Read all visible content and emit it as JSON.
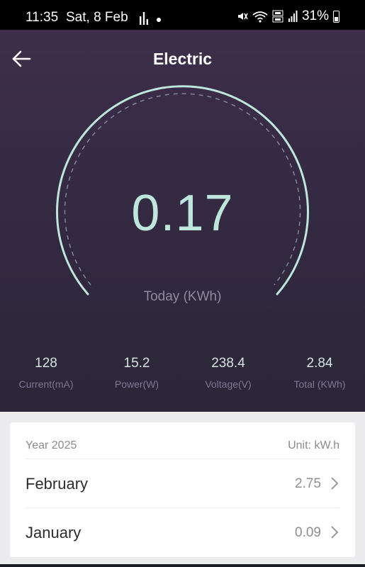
{
  "status_bar": {
    "time": "11:35",
    "date": "Sat, 8 Feb",
    "battery": "31%",
    "icons": [
      "bar-chart-icon",
      "dot-icon",
      "mute-icon",
      "wifi-6e-icon",
      "volte-icon",
      "signal-icon",
      "battery-icon"
    ]
  },
  "header": {
    "title": "Electric",
    "back_icon": "arrow-left-icon"
  },
  "gauge": {
    "value": "0.17",
    "label": "Today (KWh)",
    "color": "#bfe6dc"
  },
  "stats": [
    {
      "value": "128",
      "label": "Current(mA)"
    },
    {
      "value": "15.2",
      "label": "Power(W)"
    },
    {
      "value": "238.4",
      "label": "Voltage(V)"
    },
    {
      "value": "2.84",
      "label": "Total (KWh)"
    }
  ],
  "history": {
    "year_label": "Year 2025",
    "unit_label": "Unit: kW.h",
    "rows": [
      {
        "month": "February",
        "value": "2.75"
      },
      {
        "month": "January",
        "value": "0.09"
      }
    ]
  },
  "colors": {
    "hero_top": "#3e2e4a",
    "hero_bottom": "#2b2638",
    "accent": "#bfe6dc"
  }
}
